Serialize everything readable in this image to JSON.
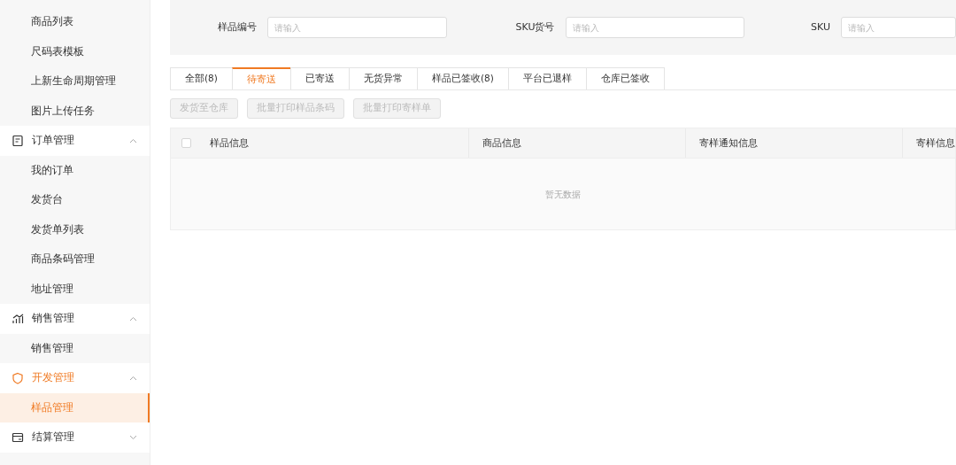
{
  "sidebar": {
    "items": [
      {
        "kind": "sub",
        "label": "商品列表",
        "selected": false
      },
      {
        "kind": "sub",
        "label": "尺码表模板",
        "selected": false
      },
      {
        "kind": "sub",
        "label": "上新生命周期管理",
        "selected": false
      },
      {
        "kind": "sub",
        "label": "图片上传任务",
        "selected": false
      },
      {
        "kind": "group",
        "label": "订单管理",
        "expanded": true,
        "active": false
      },
      {
        "kind": "sub",
        "label": "我的订单",
        "selected": false
      },
      {
        "kind": "sub",
        "label": "发货台",
        "selected": false
      },
      {
        "kind": "sub",
        "label": "发货单列表",
        "selected": false
      },
      {
        "kind": "sub",
        "label": "商品条码管理",
        "selected": false
      },
      {
        "kind": "sub",
        "label": "地址管理",
        "selected": false
      },
      {
        "kind": "group",
        "label": "销售管理",
        "expanded": true,
        "active": false
      },
      {
        "kind": "sub",
        "label": "销售管理",
        "selected": false
      },
      {
        "kind": "group",
        "label": "开发管理",
        "expanded": true,
        "active": true
      },
      {
        "kind": "sub",
        "label": "样品管理",
        "selected": true
      },
      {
        "kind": "group",
        "label": "结算管理",
        "expanded": false,
        "active": false
      }
    ]
  },
  "filters": [
    {
      "label": "样品编号",
      "placeholder": "请输入"
    },
    {
      "label": "SKU货号",
      "placeholder": "请输入"
    },
    {
      "label": "SKU",
      "placeholder": "请输入"
    }
  ],
  "tabs": [
    {
      "label": "全部(8)",
      "selected": false
    },
    {
      "label": "待寄送",
      "selected": true
    },
    {
      "label": "已寄送",
      "selected": false
    },
    {
      "label": "无货异常",
      "selected": false
    },
    {
      "label": "样品已签收(8)",
      "selected": false
    },
    {
      "label": "平台已退样",
      "selected": false
    },
    {
      "label": "仓库已签收",
      "selected": false
    }
  ],
  "actions": [
    {
      "label": "发货至仓库",
      "disabled": true
    },
    {
      "label": "批量打印样品条码",
      "disabled": true
    },
    {
      "label": "批量打印寄样单",
      "disabled": true
    }
  ],
  "table": {
    "select_all": {
      "checked": false
    },
    "columns": [
      "样品信息",
      "商品信息",
      "寄样通知信息",
      "寄样信息"
    ],
    "empty_text": "暂无数据"
  }
}
